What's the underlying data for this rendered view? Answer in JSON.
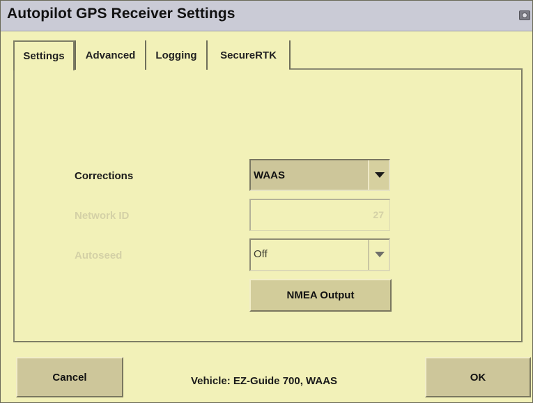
{
  "window": {
    "title": "Autopilot GPS Receiver Settings",
    "corner_icon": "camera-icon"
  },
  "tabs": [
    {
      "label": "Settings",
      "active": true
    },
    {
      "label": "Advanced",
      "active": false
    },
    {
      "label": "Logging",
      "active": false
    },
    {
      "label": "SecureRTK",
      "active": false
    }
  ],
  "form": {
    "corrections": {
      "label": "Corrections",
      "value": "WAAS",
      "enabled": true
    },
    "network_id": {
      "label": "Network ID",
      "value": "27",
      "enabled": false
    },
    "autoseed": {
      "label": "Autoseed",
      "value": "Off",
      "enabled": false
    },
    "nmea_button": "NMEA Output"
  },
  "footer": {
    "cancel_label": "Cancel",
    "status_text": "Vehicle: EZ-Guide 700, WAAS",
    "ok_label": "OK"
  },
  "colors": {
    "background": "#f2f1b8",
    "titlebar": "#cacbd6",
    "button": "#d2cc9a",
    "disabled_text": "#d4d1a6"
  }
}
